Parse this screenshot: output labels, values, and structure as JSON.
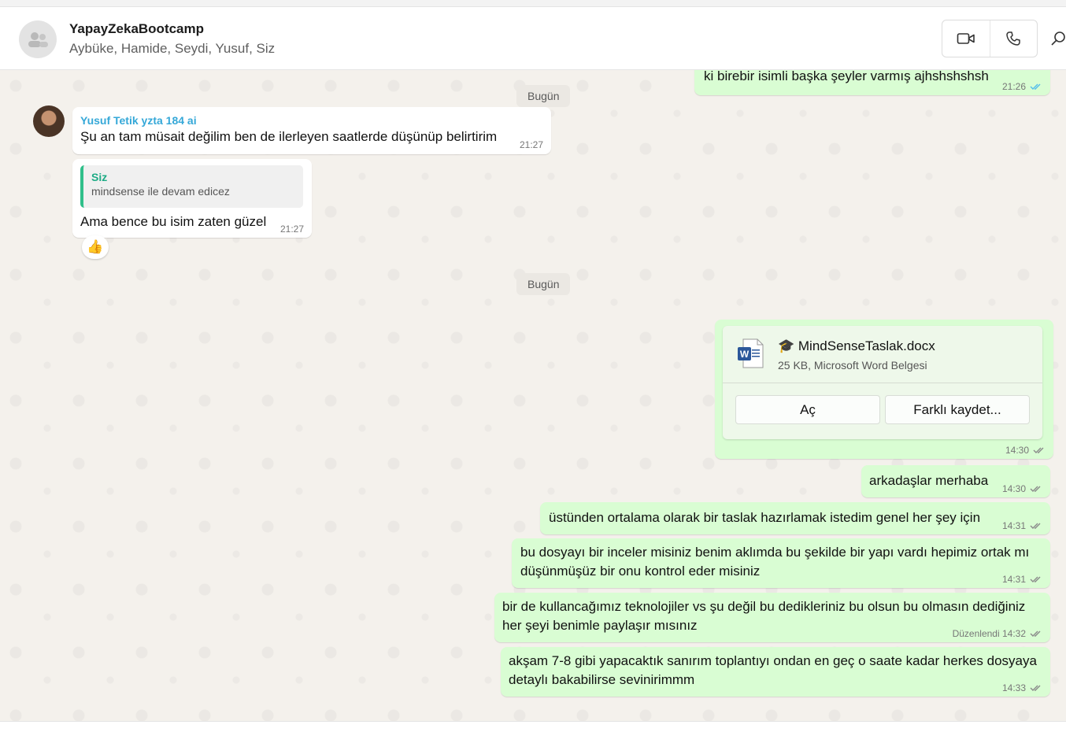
{
  "header": {
    "group_name": "YapayZekaBootcamp",
    "members": "Aybüke, Hamide, Seydi, Yusuf, Siz"
  },
  "chat": {
    "top_out_message": {
      "text": "ki birebir isimli başka şeyler varmış ajhshshshsh",
      "time": "21:26"
    },
    "divider_1": "Bugün",
    "incoming_1": {
      "sender": "Yusuf Tetik yzta 184 ai",
      "text": "Şu an tam müsait değilim ben de ilerleyen saatlerde düşünüp belirtirim",
      "time": "21:27"
    },
    "incoming_2": {
      "quote_name": "Siz",
      "quote_text": "mindsense ile devam edicez",
      "text": "Ama bence bu isim zaten güzel",
      "time": "21:27",
      "reaction": "👍"
    },
    "divider_2": "Bugün",
    "file_message": {
      "file_name": "🎓 MindSenseTaslak.docx",
      "file_info": "25 KB, Microsoft Word Belgesi",
      "open_label": "Aç",
      "save_label": "Farklı kaydet...",
      "time": "14:30"
    },
    "out_1": {
      "text": "arkadaşlar merhaba",
      "time": "14:30"
    },
    "out_2": {
      "text": "üstünden ortalama olarak bir taslak hazırlamak istedim genel her şey için",
      "time": "14:31"
    },
    "out_3": {
      "line1": "bu dosyayı bir inceler misiniz benim aklımda bu şekilde bir yapı vardı hepimiz ortak mı",
      "line2": "düşünmüşüz bir onu kontrol eder misiniz",
      "time": "14:31"
    },
    "out_4": {
      "line1": "bir de kullancağımız teknolojiler vs şu değil bu dedikleriniz bu olsun bu olmasın dediğiniz",
      "line2": "her şeyi benimle paylaşır mısınız",
      "time": "Düzenlendi 14:32"
    },
    "out_5": {
      "line1": "akşam 7-8 gibi yapacaktık sanırım toplantıyı ondan en geç o saate kadar herkes dosyaya",
      "line2": "detaylı bakabilirse sevinirimmm",
      "time": "14:33"
    }
  },
  "colors": {
    "outgoing_bubble": "#d9fdd3",
    "incoming_bubble": "#ffffff",
    "sender_name": "#35a8d8",
    "quote_accent": "#1dab85",
    "read_tick": "#53bdeb",
    "delivered_tick": "#8a8a8a"
  },
  "icons": [
    "group-avatar-icon",
    "video-call-icon",
    "phone-icon",
    "search-icon",
    "word-file-icon",
    "double-tick-icon"
  ]
}
